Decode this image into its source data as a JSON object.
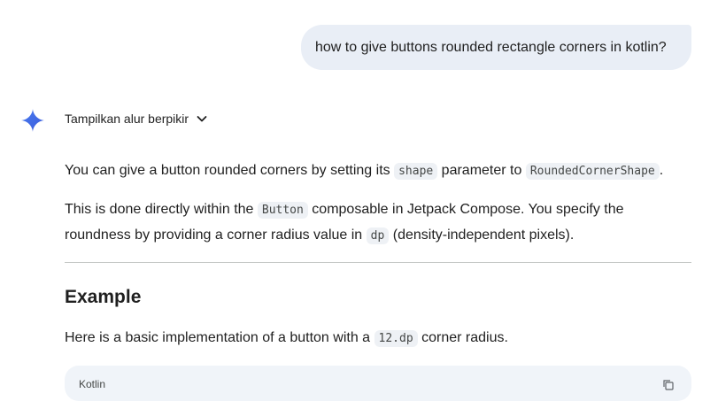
{
  "user_message": "how to give buttons rounded rectangle corners in kotlin?",
  "response": {
    "thinking_toggle_label": "Tampilkan alur berpikir",
    "p1": {
      "t1": "You can give a button rounded corners by setting its ",
      "c1": "shape",
      "t2": " parameter to ",
      "c2": "RoundedCornerShape",
      "t3": "."
    },
    "p2": {
      "t1": "This is done directly within the ",
      "c1": "Button",
      "t2": " composable in Jetpack Compose. You specify the",
      "t3": "roundness by providing a corner radius value in ",
      "c2": "dp",
      "t4": " (density-independent pixels)."
    },
    "heading": "Example",
    "p3": {
      "t1": "Here is a basic implementation of a button with a ",
      "c1": "12.dp",
      "t2": " corner radius."
    },
    "code_block": {
      "language": "Kotlin"
    }
  },
  "icons": {
    "assistant": "sparkle-icon",
    "toggle": "chevron-down-icon",
    "copy": "copy-icon"
  },
  "colors": {
    "sparkle": "#4a7cf0",
    "user_bubble": "#e9eef6",
    "code_bg": "#eef1f5",
    "divider": "#c4c7c5"
  }
}
